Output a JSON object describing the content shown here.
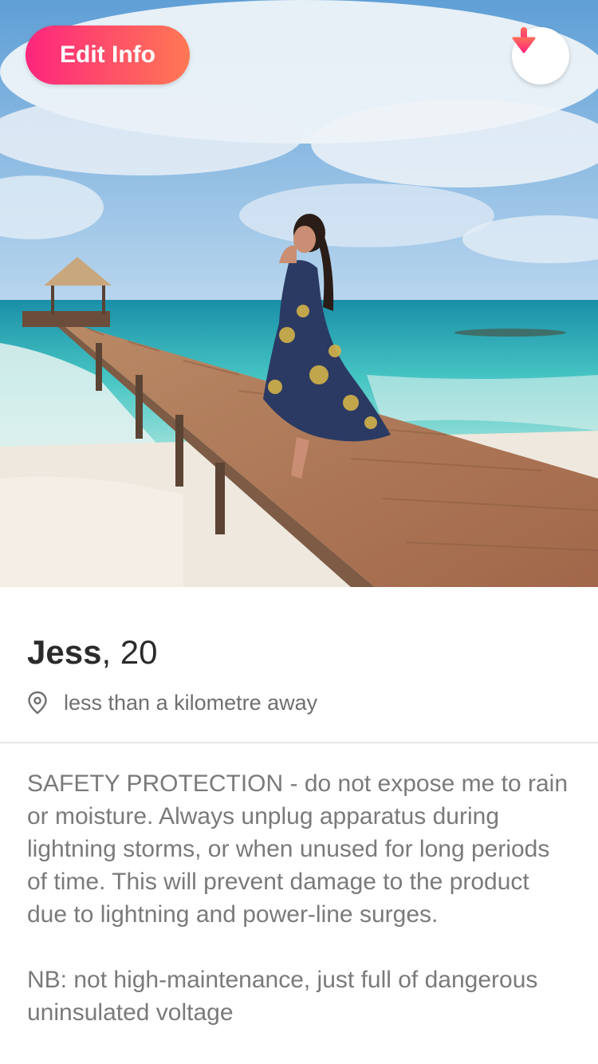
{
  "header": {
    "edit_button_label": "Edit Info",
    "collapse_icon": "arrow-down-icon",
    "accent_gradient": [
      "#fd267d",
      "#ff7854"
    ]
  },
  "profile": {
    "name": "Jess",
    "age_separator": ", ",
    "age": "20",
    "distance": "less than a kilometre away",
    "location_icon": "location-pin-icon"
  },
  "bio": {
    "paragraph_1": "SAFETY PROTECTION - do not expose me to rain or moisture. Always unplug apparatus during lightning storms, or when unused for long periods of time. This will prevent damage to the product due to lightning and power-line surges.",
    "paragraph_2": "NB: not high-maintenance, just full of dangerous uninsulated voltage"
  }
}
